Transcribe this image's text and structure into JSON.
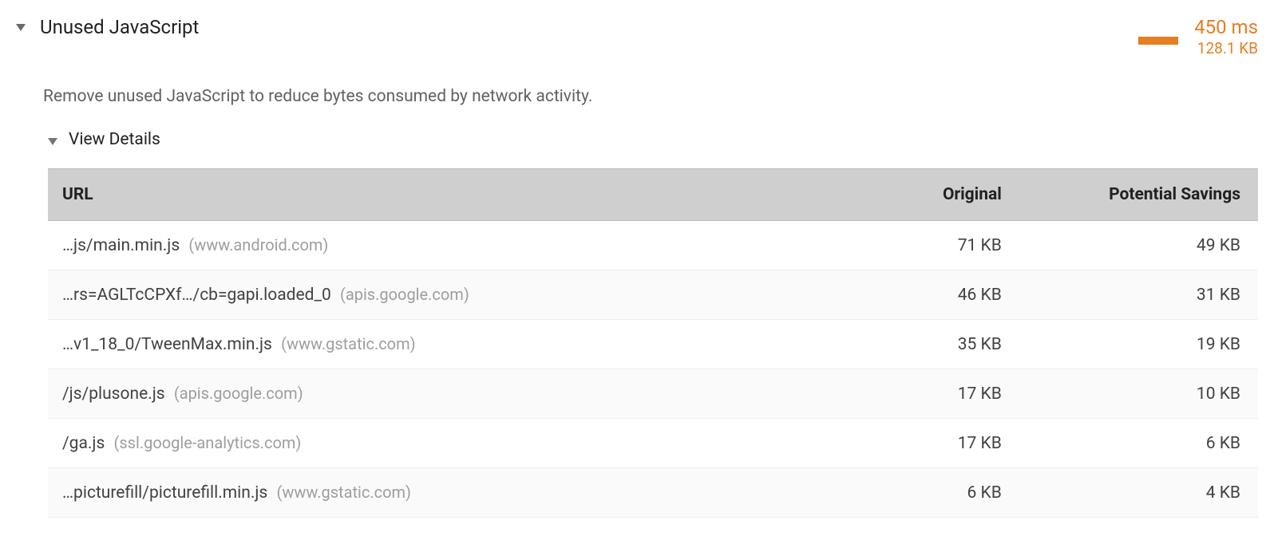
{
  "audit": {
    "title": "Unused JavaScript",
    "time": "450 ms",
    "size": "128.1 KB",
    "description": "Remove unused JavaScript to reduce bytes consumed by network activity.",
    "view_details_label": "View Details",
    "columns": {
      "url": "URL",
      "original": "Original",
      "savings": "Potential Savings"
    },
    "rows": [
      {
        "path": "…js/main.min.js",
        "host": "(www.android.com)",
        "original": "71 KB",
        "savings": "49 KB"
      },
      {
        "path": "…rs=AGLTcCPXf…/cb=gapi.loaded_0",
        "host": "(apis.google.com)",
        "original": "46 KB",
        "savings": "31 KB"
      },
      {
        "path": "…v1_18_0/TweenMax.min.js",
        "host": "(www.gstatic.com)",
        "original": "35 KB",
        "savings": "19 KB"
      },
      {
        "path": "/js/plusone.js",
        "host": "(apis.google.com)",
        "original": "17 KB",
        "savings": "10 KB"
      },
      {
        "path": "/ga.js",
        "host": "(ssl.google-analytics.com)",
        "original": "17 KB",
        "savings": "6 KB"
      },
      {
        "path": "…picturefill/picturefill.min.js",
        "host": "(www.gstatic.com)",
        "original": "6 KB",
        "savings": "4 KB"
      }
    ]
  }
}
